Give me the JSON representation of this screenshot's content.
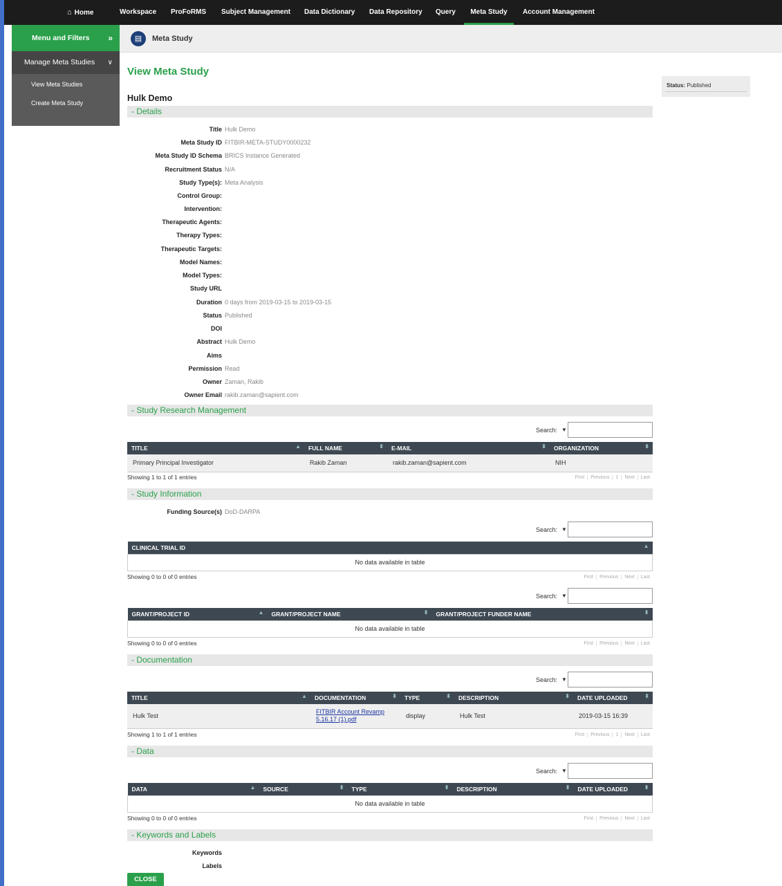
{
  "nav": {
    "home": "Home",
    "items": [
      "Workspace",
      "ProFoRMS",
      "Subject Management",
      "Data Dictionary",
      "Data Repository",
      "Query",
      "Meta Study",
      "Account Management"
    ]
  },
  "sidebar": {
    "header": "Menu and Filters",
    "manage": "Manage Meta Studies",
    "sub_items": [
      "View Meta Studies",
      "Create Meta Study"
    ]
  },
  "page_header": {
    "title": "Meta Study"
  },
  "main": {
    "view_title": "View Meta Study",
    "study_name": "Hulk Demo",
    "status_label": "Status:",
    "status_value": "Published"
  },
  "sections": {
    "details": "- Details",
    "research": "- Study Research Management",
    "information": "- Study Information",
    "documentation": "- Documentation",
    "data": "- Data",
    "keywords": "- Keywords and Labels"
  },
  "details": [
    {
      "label": "Title",
      "value": "Hulk Demo"
    },
    {
      "label": "Meta Study ID",
      "value": "FITBIR-META-STUDY0000232"
    },
    {
      "label": "Meta Study ID Schema",
      "value": "BRICS Instance Generated"
    },
    {
      "label": "Recruitment Status",
      "value": "N/A"
    },
    {
      "label": "Study Type(s):",
      "value": "Meta Analysis"
    },
    {
      "label": "Control Group:",
      "value": ""
    },
    {
      "label": "Intervention:",
      "value": ""
    },
    {
      "label": "Therapeutic Agents:",
      "value": ""
    },
    {
      "label": "Therapy Types:",
      "value": ""
    },
    {
      "label": "Therapeutic Targets:",
      "value": ""
    },
    {
      "label": "Model Names:",
      "value": ""
    },
    {
      "label": "Model Types:",
      "value": ""
    },
    {
      "label": "Study URL",
      "value": ""
    },
    {
      "label": "Duration",
      "value": "0 days from 2019-03-15 to 2019-03-15"
    },
    {
      "label": "Status",
      "value": "Published"
    },
    {
      "label": "DOI",
      "value": ""
    },
    {
      "label": "Abstract",
      "value": "Hulk Demo"
    },
    {
      "label": "Aims",
      "value": ""
    },
    {
      "label": "Permission",
      "value": "Read"
    },
    {
      "label": "Owner",
      "value": "Zaman, Rakib"
    },
    {
      "label": "Owner Email",
      "value": "rakib.zaman@sapient.com"
    }
  ],
  "search": {
    "label": "Search:"
  },
  "research_table": {
    "headers": [
      "TITLE",
      "FULL NAME",
      "E-MAIL",
      "ORGANIZATION"
    ],
    "rows": [
      [
        "Primary Principal Investigator",
        "Rakib Zaman",
        "rakib.zaman@sapient.com",
        "NIH"
      ]
    ],
    "showing": "Showing 1 to 1 of 1 entries"
  },
  "funding": {
    "label": "Funding Source(s)",
    "value": "DoD-DARPA"
  },
  "clinical_table": {
    "headers": [
      "CLINICAL TRIAL ID"
    ],
    "empty": "No data available in table",
    "showing": "Showing 0 to 0 of 0 entries"
  },
  "grant_table": {
    "headers": [
      "GRANT/PROJECT ID",
      "GRANT/PROJECT NAME",
      "GRANT/PROJECT FUNDER NAME"
    ],
    "empty": "No data available in table",
    "showing": "Showing 0 to 0 of 0 entries"
  },
  "doc_table": {
    "headers": [
      "TITLE",
      "DOCUMENTATION",
      "TYPE",
      "DESCRIPTION",
      "DATE UPLOADED"
    ],
    "rows": [
      {
        "title": "Hulk Test",
        "doc_line1": "FITBIR Account Revamp",
        "doc_line2": "5.16.17 (1).pdf",
        "type": "display",
        "description": "Hulk Test",
        "date": "2019-03-15 16:39"
      }
    ],
    "showing": "Showing 1 to 1 of 1 entries"
  },
  "data_table": {
    "headers": [
      "DATA",
      "SOURCE",
      "TYPE",
      "DESCRIPTION",
      "DATE UPLOADED"
    ],
    "empty": "No data available in table",
    "showing": "Showing 0 to 0 of 0 entries"
  },
  "pager": {
    "with_page": [
      "First",
      "Previous",
      "1",
      "Next",
      "Last"
    ],
    "without_page": [
      "First",
      "Previous",
      "Next",
      "Last"
    ]
  },
  "keywords": {
    "keywords_label": "Keywords",
    "labels_label": "Labels"
  },
  "buttons": {
    "close": "CLOSE"
  }
}
